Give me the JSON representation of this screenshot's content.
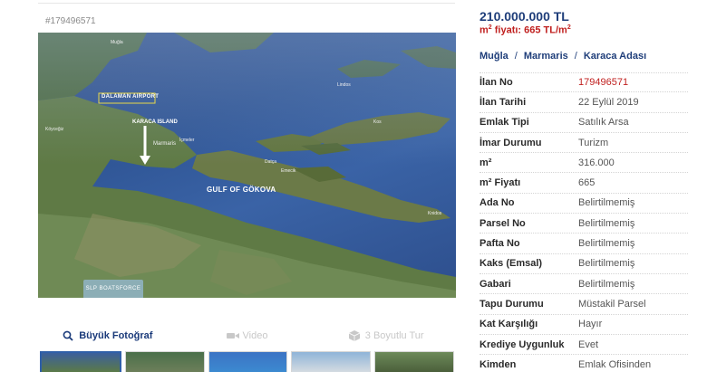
{
  "listing_code": "#179496571",
  "price": "210.000.000 TL",
  "unit_price": {
    "prefix": "m",
    "sup": "2",
    "text": " fiyatı: 665 TL/m",
    "sup2": "2"
  },
  "breadcrumb": [
    "Muğla",
    "Marmaris",
    "Karaca Adası"
  ],
  "photo": {
    "labels": {
      "airport": "DALAMAN AIRPORT",
      "island": "KARACA ISLAND",
      "gulf": "GULF OF GÖKOVA",
      "marmaris": "Marmaris",
      "lindos": "Lindos",
      "datca": "Datça",
      "emecik": "Emecik",
      "knidos": "Knidos",
      "kos": "Kos",
      "icmeler": "İçmeler",
      "mugla": "Muğla",
      "koycegiz": "Köyceğiz"
    },
    "watermark": "SLP BOATSFORCE"
  },
  "tabs": [
    {
      "label": "Büyük Fotoğraf",
      "icon": "magnifier-icon",
      "active": true
    },
    {
      "label": "Video",
      "icon": "video-camera-icon",
      "active": false
    },
    {
      "label": "3 Boyutlu Tur",
      "icon": "cube-icon",
      "active": false
    }
  ],
  "info": [
    {
      "label": "İlan No",
      "value": "179496571",
      "highlight": true
    },
    {
      "label": "İlan Tarihi",
      "value": "22 Eylül 2019"
    },
    {
      "label": "Emlak Tipi",
      "value": "Satılık Arsa"
    },
    {
      "label": "İmar Durumu",
      "value": "Turizm"
    },
    {
      "label": "m²",
      "value": "316.000"
    },
    {
      "label": "m² Fiyatı",
      "value": "665"
    },
    {
      "label": "Ada No",
      "value": "Belirtilmemiş"
    },
    {
      "label": "Parsel No",
      "value": "Belirtilmemiş"
    },
    {
      "label": "Pafta No",
      "value": "Belirtilmemiş"
    },
    {
      "label": "Kaks (Emsal)",
      "value": "Belirtilmemiş"
    },
    {
      "label": "Gabari",
      "value": "Belirtilmemiş"
    },
    {
      "label": "Tapu Durumu",
      "value": "Müstakil Parsel"
    },
    {
      "label": "Kat Karşılığı",
      "value": "Hayır"
    },
    {
      "label": "Krediye Uygunluk",
      "value": "Evet"
    },
    {
      "label": "Kimden",
      "value": "Emlak Ofisinden"
    }
  ],
  "colors": {
    "link": "#1f3e7a",
    "accent_red": "#c0201f",
    "sea": "#3059a0"
  }
}
